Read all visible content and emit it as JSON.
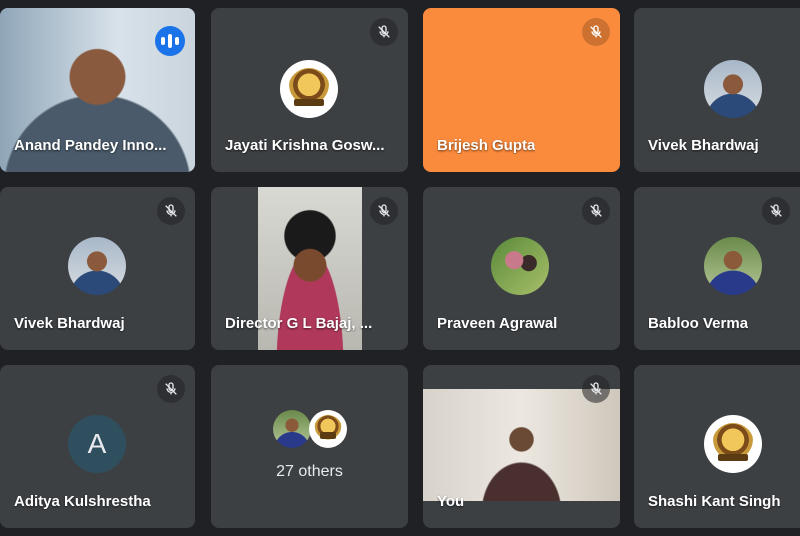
{
  "participants": [
    {
      "name": "Anand Pandey Inno...",
      "speaking": true
    },
    {
      "name": "Jayati Krishna Gosw...",
      "muted": true
    },
    {
      "name": "Brijesh Gupta",
      "muted": true
    },
    {
      "name": "Vivek Bhardwaj"
    },
    {
      "name": "Vivek Bhardwaj",
      "muted": true
    },
    {
      "name": "Director G L Bajaj, ...",
      "muted": true
    },
    {
      "name": "Praveen Agrawal",
      "muted": true
    },
    {
      "name": "Babloo Verma",
      "muted": true
    },
    {
      "name": "Aditya Kulshrestha",
      "muted": true,
      "initial": "A"
    },
    {
      "name": "27 others"
    },
    {
      "name": "You",
      "muted": true
    },
    {
      "name": "Shashi Kant Singh"
    }
  ],
  "colors": {
    "background": "#202124",
    "tile": "#3c4043",
    "orange_tile": "#fa8a3c",
    "speaking_border": "#8ab4f8",
    "speaking_badge": "#1a73e8"
  },
  "icons": {
    "muted": "mic-off-icon",
    "speaking": "audio-levels-icon"
  }
}
